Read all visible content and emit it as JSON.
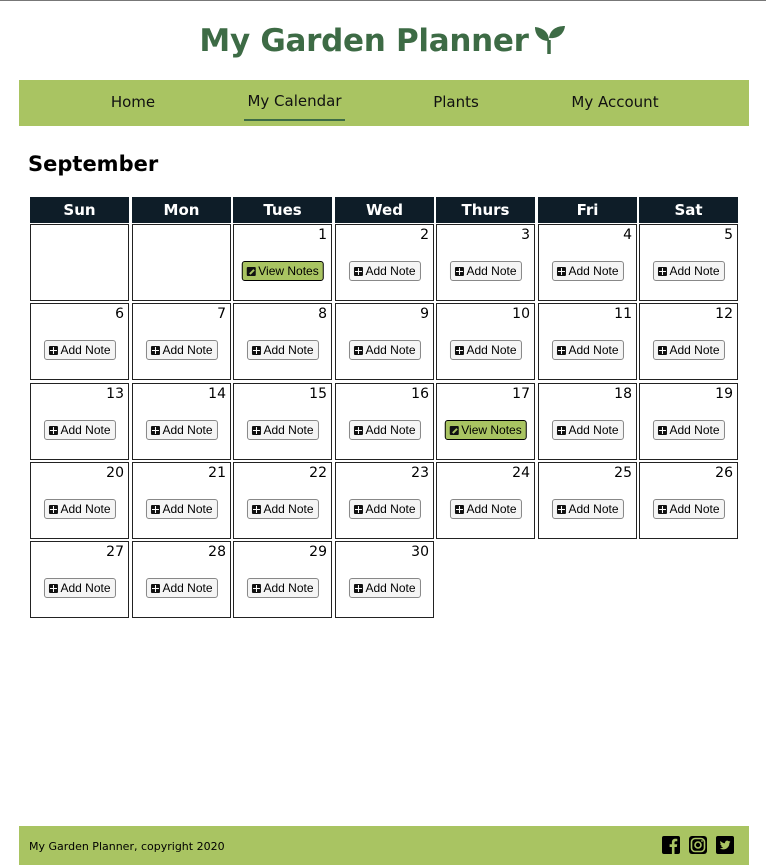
{
  "header": {
    "title": "My Garden Planner",
    "logo_icon": "sprout-icon",
    "title_color": "#3d6b45"
  },
  "nav": {
    "background": "#a9c462",
    "items": [
      {
        "label": "Home",
        "active": false
      },
      {
        "label": "My Calendar",
        "active": true
      },
      {
        "label": "Plants",
        "active": false
      },
      {
        "label": "My Account",
        "active": false
      }
    ]
  },
  "calendar": {
    "month": "September",
    "weekdays": [
      "Sun",
      "Mon",
      "Tues",
      "Wed",
      "Thurs",
      "Fri",
      "Sat"
    ],
    "start_weekday_index": 2,
    "days_in_month": 30,
    "add_label": "Add Note",
    "view_label": "View Notes",
    "days_with_notes": [
      1,
      17
    ],
    "add_icon": "plus-square-icon",
    "view_icon": "edit-icon"
  },
  "footer": {
    "copyright": "My Garden Planner, copyright 2020",
    "social_icons": [
      "facebook-icon",
      "instagram-icon",
      "twitter-icon"
    ]
  }
}
